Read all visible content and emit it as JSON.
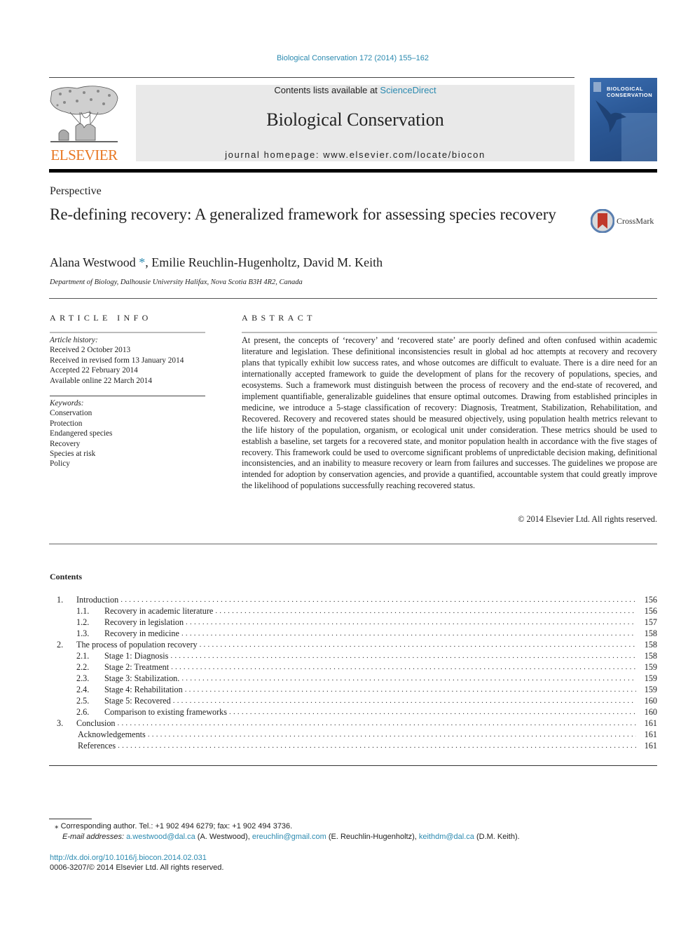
{
  "header": {
    "citation": "Biological Conservation 172 (2014) 155–162",
    "contents_prefix": "Contents lists available at ",
    "contents_link": "ScienceDirect",
    "journal_title": "Biological Conservation",
    "homepage": "journal homepage: www.elsevier.com/locate/biocon",
    "publisher_logo": "ELSEVIER",
    "cover_title_line1": "BIOLOGICAL",
    "cover_title_line2": "CONSERVATION",
    "crossmark": "CrossMark"
  },
  "article": {
    "type": "Perspective",
    "title": "Re-defining recovery: A generalized framework for assessing species recovery",
    "authors": [
      {
        "name": "Alana Westwood",
        "mark": "*"
      },
      {
        "name": "Emilie Reuchlin-Hugenholtz"
      },
      {
        "name": "David M. Keith"
      }
    ],
    "affiliation": "Department of Biology, Dalhousie University Halifax, Nova Scotia B3H 4R2, Canada"
  },
  "article_info": {
    "heading": "ARTICLE INFO",
    "history_label": "Article history:",
    "history": [
      "Received 2 October 2013",
      "Received in revised form 13 January 2014",
      "Accepted 22 February 2014",
      "Available online 22 March 2014"
    ],
    "keywords_label": "Keywords:",
    "keywords": [
      "Conservation",
      "Protection",
      "Endangered species",
      "Recovery",
      "Species at risk",
      "Policy"
    ]
  },
  "abstract": {
    "heading": "ABSTRACT",
    "text": "At present, the concepts of ‘recovery’ and ‘recovered state’ are poorly defined and often confused within academic literature and legislation. These definitional inconsistencies result in global ad hoc attempts at recovery and recovery plans that typically exhibit low success rates, and whose outcomes are difficult to evaluate. There is a dire need for an internationally accepted framework to guide the development of plans for the recovery of populations, species, and ecosystems. Such a framework must distinguish between the process of recovery and the end-state of recovered, and implement quantifiable, generaliz­able guidelines that ensure optimal outcomes. Drawing from established principles in medicine, we introduce a 5-stage classification of recovery: Diagnosis, Treatment, Stabilization, Rehabilitation, and Recovered. Recovery and recovered states should be measured objectively, using population health met­rics relevant to the life history of the population, organism, or ecological unit under consideration. These metrics should be used to establish a baseline, set targets for a recovered state, and monitor population health in accordance with the five stages of recovery. This framework could be used to overcome signif­icant problems of unpredictable decision making, definitional inconsistencies, and an inability to mea­sure recovery or learn from failures and successes. The guidelines we propose are intended for adoption by conservation agencies, and provide a quantified, accountable system that could greatly improve the likelihood of populations successfully reaching recovered status.",
    "copyright": "© 2014 Elsevier Ltd. All rights reserved."
  },
  "contents": {
    "heading": "Contents",
    "items": [
      {
        "num": "1.",
        "label": "Introduction",
        "page": "156",
        "level": "main"
      },
      {
        "num": "1.1.",
        "label": "Recovery in academic literature",
        "page": "156",
        "level": "sub"
      },
      {
        "num": "1.2.",
        "label": "Recovery in legislation",
        "page": "157",
        "level": "sub"
      },
      {
        "num": "1.3.",
        "label": "Recovery in medicine",
        "page": "158",
        "level": "sub"
      },
      {
        "num": "2.",
        "label": "The process of population recovery",
        "page": "158",
        "level": "main"
      },
      {
        "num": "2.1.",
        "label": "Stage 1: Diagnosis",
        "page": "158",
        "level": "sub"
      },
      {
        "num": "2.2.",
        "label": "Stage 2: Treatment",
        "page": "159",
        "level": "sub"
      },
      {
        "num": "2.3.",
        "label": "Stage 3: Stabilization.",
        "page": "159",
        "level": "sub"
      },
      {
        "num": "2.4.",
        "label": "Stage 4: Rehabilitation",
        "page": "159",
        "level": "sub"
      },
      {
        "num": "2.5.",
        "label": "Stage 5: Recovered",
        "page": "160",
        "level": "sub"
      },
      {
        "num": "2.6.",
        "label": "Comparison to existing frameworks",
        "page": "160",
        "level": "sub"
      },
      {
        "num": "3.",
        "label": "Conclusion",
        "page": "161",
        "level": "main"
      },
      {
        "num": "",
        "label": "Acknowledgements",
        "page": "161",
        "level": "plain"
      },
      {
        "num": "",
        "label": "References",
        "page": "161",
        "level": "plain"
      }
    ]
  },
  "footnotes": {
    "corresponding_mark": "⁎",
    "corresponding": "Corresponding author. Tel.: +1 902 494 6279; fax: +1 902 494 3736.",
    "email_label": "E-mail addresses:",
    "emails": [
      {
        "address": "a.westwood@dal.ca",
        "who": "(A. Westwood),"
      },
      {
        "address": "ereuchlin@gmail.com",
        "who": "(E. Reuchlin-Hugenholtz),"
      },
      {
        "address": "keithdm@dal.ca",
        "who": "(D.M. Keith)."
      }
    ],
    "doi": "http://dx.doi.org/10.1016/j.biocon.2014.02.031",
    "issn": "0006-3207/© 2014 Elsevier Ltd. All rights reserved."
  },
  "colors": {
    "link": "#2b8ab0",
    "elsevier_orange": "#e87722",
    "header_box": "#e9e9e9",
    "cover_blue": "#2b5896"
  }
}
